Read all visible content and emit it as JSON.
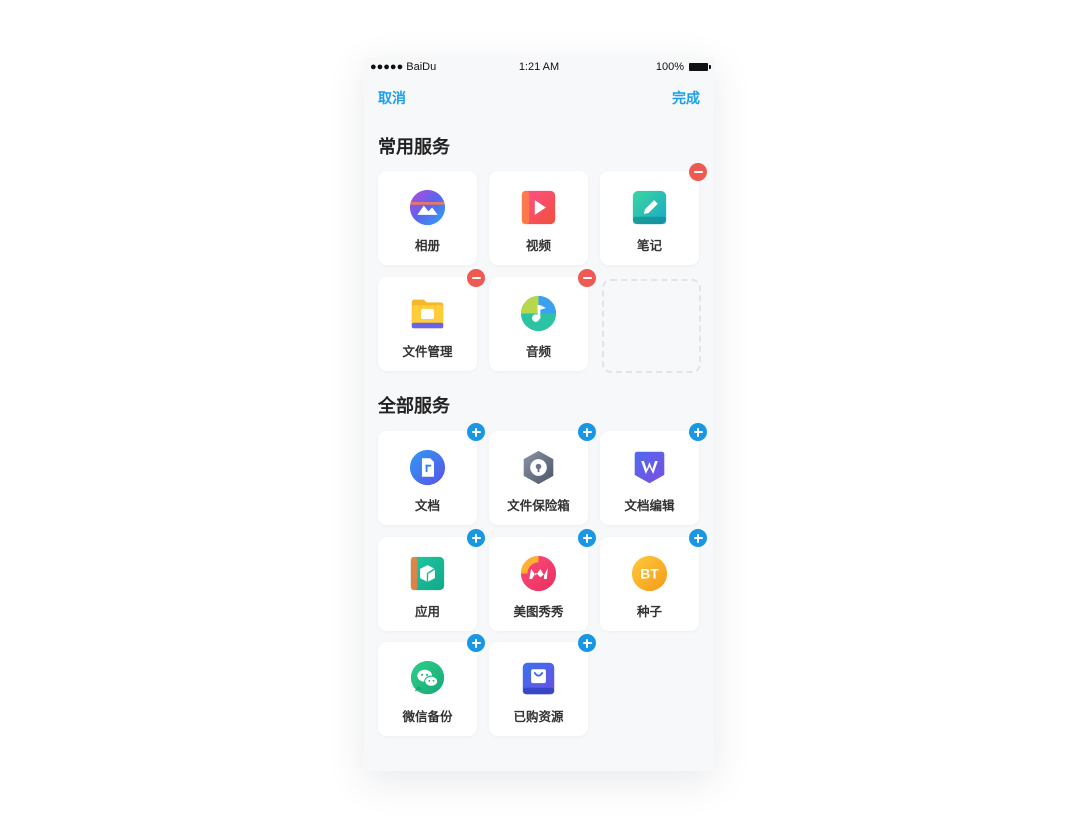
{
  "status_bar": {
    "carrier": "●●●●● BaiDu",
    "time": "1:21 AM",
    "battery": "100%"
  },
  "nav": {
    "cancel": "取消",
    "done": "完成"
  },
  "sections": {
    "common_title": "常用服务",
    "all_title": "全部服务"
  },
  "common_services": [
    {
      "label": "相册",
      "icon": "photo-album-icon",
      "badge": "none"
    },
    {
      "label": "视频",
      "icon": "video-icon",
      "badge": "none"
    },
    {
      "label": "笔记",
      "icon": "notes-icon",
      "badge": "remove"
    },
    {
      "label": "文件管理",
      "icon": "folder-icon",
      "badge": "remove"
    },
    {
      "label": "音频",
      "icon": "audio-icon",
      "badge": "remove"
    }
  ],
  "all_services": [
    {
      "label": "文档",
      "icon": "document-icon",
      "badge": "add"
    },
    {
      "label": "文件保险箱",
      "icon": "safe-box-icon",
      "badge": "add"
    },
    {
      "label": "文档编辑",
      "icon": "doc-edit-icon",
      "badge": "add"
    },
    {
      "label": "应用",
      "icon": "apps-icon",
      "badge": "add"
    },
    {
      "label": "美图秀秀",
      "icon": "meitu-icon",
      "badge": "add"
    },
    {
      "label": "种子",
      "icon": "torrent-icon",
      "badge": "add",
      "icon_text": "BT"
    },
    {
      "label": "微信备份",
      "icon": "wechat-backup-icon",
      "badge": "add"
    },
    {
      "label": "已购资源",
      "icon": "purchased-icon",
      "badge": "add"
    }
  ],
  "colors": {
    "accent": "#1aa0e8",
    "remove_badge": "#ee5a52",
    "add_badge": "#1997e4",
    "background": "#f7f8fa"
  }
}
